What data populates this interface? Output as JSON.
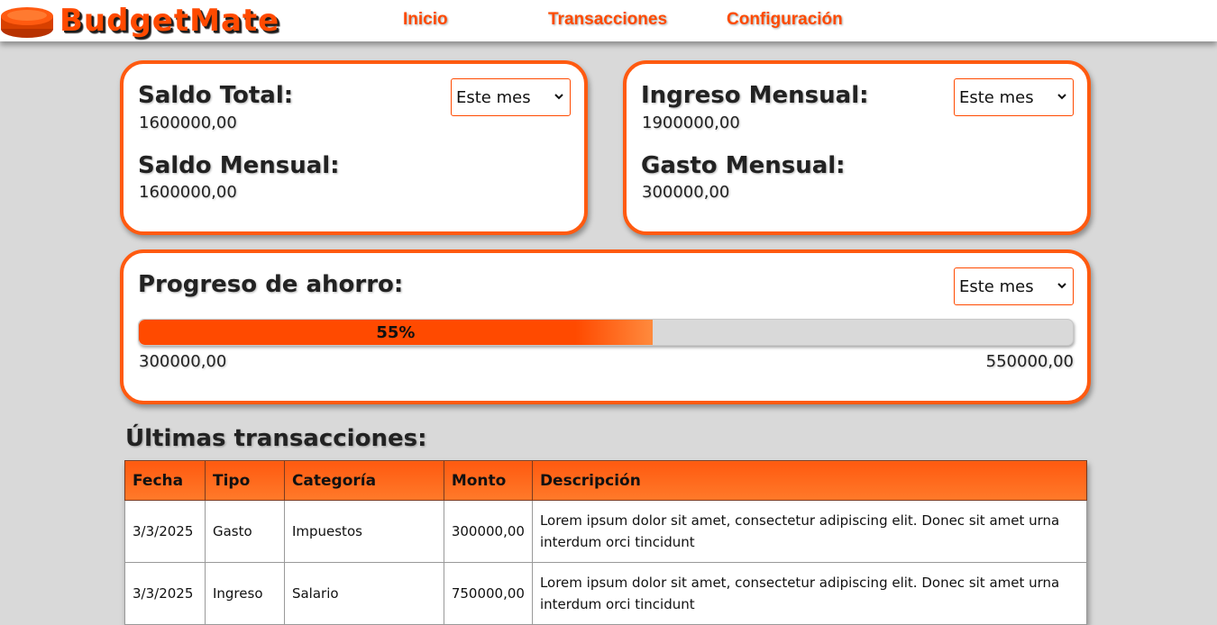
{
  "app": {
    "logo_text": "BudgetMate",
    "accent_color": "#ff4a00"
  },
  "nav": {
    "items": [
      {
        "label": "Inicio"
      },
      {
        "label": "Transacciones"
      },
      {
        "label": "Configuración"
      }
    ]
  },
  "cards": {
    "balance": {
      "total_label": "Saldo Total:",
      "total_value": "1600000,00",
      "monthly_label": "Saldo Mensual:",
      "monthly_value": "1600000,00",
      "period": "Este mes"
    },
    "income_expense": {
      "income_label": "Ingreso Mensual:",
      "income_value": "1900000,00",
      "expense_label": "Gasto Mensual:",
      "expense_value": "300000,00",
      "period": "Este mes"
    },
    "savings": {
      "label": "Progreso de ahorro:",
      "period": "Este mes",
      "progress_percent": 55,
      "progress_text": "55%",
      "current_value": "300000,00",
      "goal_value": "550000,00"
    }
  },
  "transactions": {
    "title": "Últimas transacciones:",
    "columns": [
      "Fecha",
      "Tipo",
      "Categoría",
      "Monto",
      "Descripción"
    ],
    "rows": [
      {
        "fecha": "3/3/2025",
        "tipo": "Gasto",
        "categoria": "Impuestos",
        "monto": "300000,00",
        "descripcion": "Lorem ipsum dolor sit amet, consectetur adipiscing elit. Donec sit amet urna interdum orci tincidunt"
      },
      {
        "fecha": "3/3/2025",
        "tipo": "Ingreso",
        "categoria": "Salario",
        "monto": "750000,00",
        "descripcion": "Lorem ipsum dolor sit amet, consectetur adipiscing elit. Donec sit amet urna interdum orci tincidunt"
      }
    ]
  },
  "icons": {
    "logo": "coin-stack-icon",
    "select": "chevron-down-icon"
  }
}
